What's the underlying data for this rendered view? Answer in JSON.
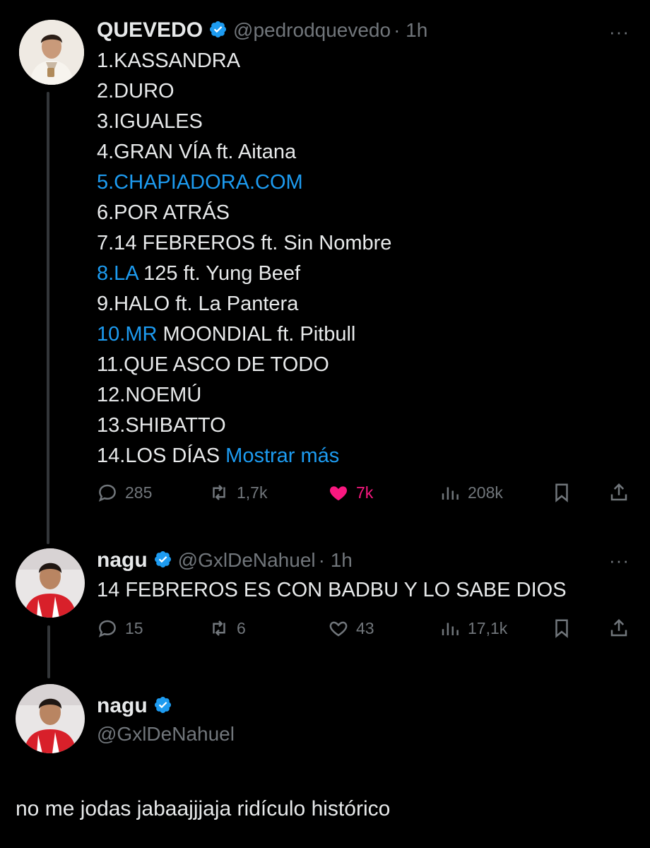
{
  "tweet1": {
    "author_name": "QUEVEDO",
    "handle": "@pedrodquevedo",
    "time": "· 1h",
    "more": "···",
    "lines": [
      {
        "pre": "1.KASSANDRA"
      },
      {
        "pre": "2.DURO"
      },
      {
        "pre": "3.IGUALES"
      },
      {
        "pre": "4.GRAN VÍA ft. Aitana"
      },
      {
        "link": "5.CHAPIADORA.COM"
      },
      {
        "pre": "6.POR ATRÁS"
      },
      {
        "pre": "7.14 FEBREROS ft. Sin Nombre"
      },
      {
        "link": "8.LA",
        "post": " 125 ft. Yung Beef"
      },
      {
        "pre": "9.HALO ft. La Pantera"
      },
      {
        "link": "10.MR",
        "post": " MOONDIAL ft. Pitbull"
      },
      {
        "pre": "11.QUE ASCO DE TODO"
      },
      {
        "pre": "12.NOEMÚ"
      },
      {
        "pre": "13.SHIBATTO"
      },
      {
        "pre": "14.LOS DÍAS ",
        "link2": "Mostrar más"
      }
    ],
    "stats": {
      "replies": "285",
      "retweets": "1,7k",
      "likes": "7k",
      "views": "208k"
    }
  },
  "tweet2": {
    "author_name": "nagu",
    "handle": "@GxlDeNahuel",
    "time": "· 1h",
    "more": "···",
    "text": "14 FEBREROS ES CON BADBU Y LO SABE DIOS",
    "stats": {
      "replies": "15",
      "retweets": "6",
      "likes": "43",
      "views": "17,1k"
    }
  },
  "tweet3": {
    "author_name": "nagu",
    "handle": "@GxlDeNahuel",
    "text": "no me jodas jabaajjjaja ridículo histórico"
  },
  "colors": {
    "background": "#000000",
    "text": "#e7e9ea",
    "muted": "#71767b",
    "link": "#1d9bf0",
    "like": "#f91880",
    "verified": "#1d9bf0"
  },
  "icons": [
    "verified-badge-icon",
    "reply-icon",
    "retweet-icon",
    "like-icon",
    "views-icon",
    "bookmark-icon",
    "share-icon",
    "more-icon"
  ]
}
